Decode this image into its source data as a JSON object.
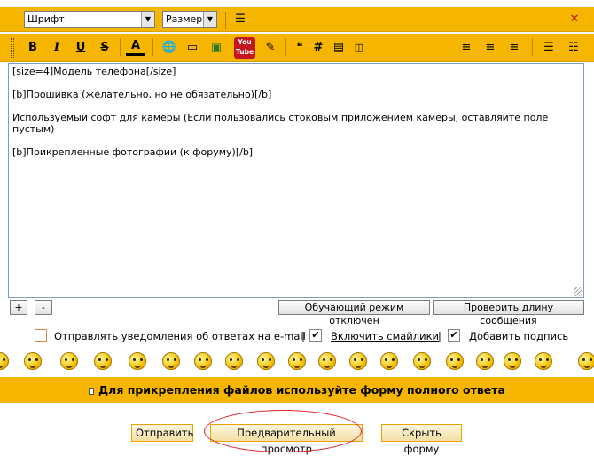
{
  "toolbar_top": {
    "font_select": "Шрифт",
    "size_select": "Размер",
    "icons": [
      "indent-icon",
      "close-icon"
    ]
  },
  "toolbar_format": {
    "bold": "B",
    "italic": "I",
    "underline": "U",
    "strike": "S",
    "font_color": "A",
    "youtube_label": "You Tube"
  },
  "editor": {
    "lines": [
      "[size=4]Модель телефона[/size]",
      "[b]Прошивка (желательно, но не обязательно)[/b]",
      "Используемый софт для камеры (Если пользовались стоковым приложением камеры, оставляйте поле пустым)",
      "[b]Прикрепленные фотографии (к форуму)[/b]"
    ]
  },
  "editor_controls": {
    "plus": "+",
    "minus": "-",
    "learning_mode": "Обучающий режим отключен",
    "check_length": "Проверить длину сообщения"
  },
  "options": {
    "notify_label": "Отправлять уведомления об ответах на e-mail",
    "notify_checked": false,
    "separator": "|",
    "smilies_label": "Включить смайлики",
    "smilies_checked": true,
    "signature_label": "Добавить подпись",
    "signature_checked": true,
    "check_mark": "✔"
  },
  "attach_notice": "Для прикрепления файлов используйте форму полного ответа",
  "form_buttons": {
    "send": "Отправить",
    "preview": "Предварительный просмотр",
    "hide": "Скрыть форму"
  },
  "colors": {
    "accent": "#f6b600",
    "highlight_circle": "#e02020"
  }
}
